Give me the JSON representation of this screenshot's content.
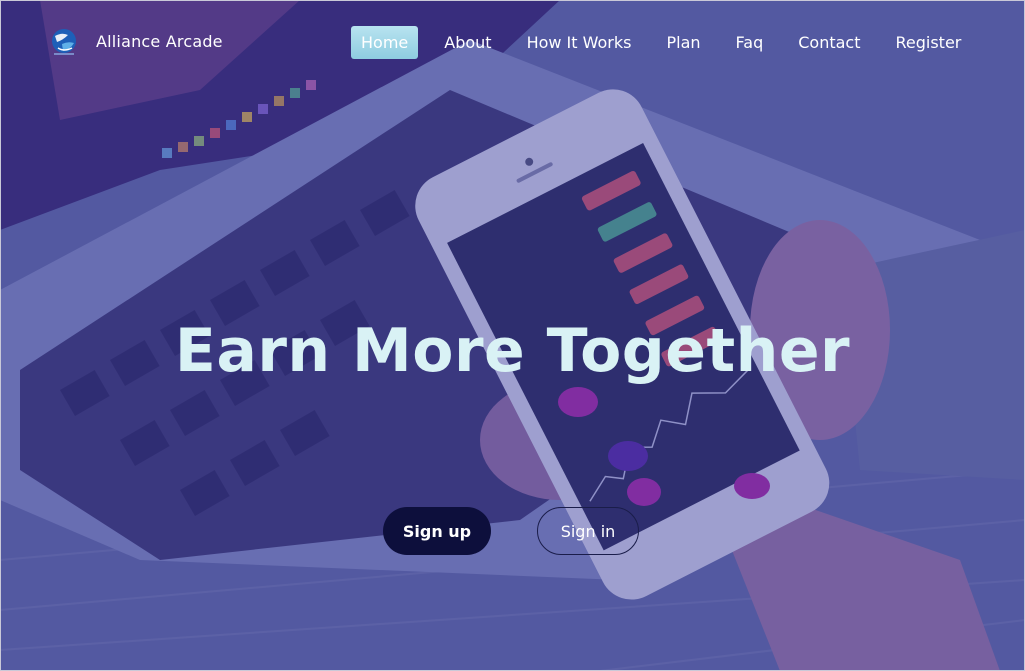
{
  "brand": {
    "name": "Alliance Arcade",
    "logo_icon": "globe-logo-icon"
  },
  "nav": {
    "items": [
      {
        "label": "Home",
        "active": true
      },
      {
        "label": "About",
        "active": false
      },
      {
        "label": "How It Works",
        "active": false
      },
      {
        "label": "Plan",
        "active": false
      },
      {
        "label": "Faq",
        "active": false
      },
      {
        "label": "Contact",
        "active": false
      },
      {
        "label": "Register",
        "active": false
      }
    ]
  },
  "hero": {
    "headline": "Earn More Together",
    "signup_label": "Sign up",
    "signin_label": "Sign in",
    "background_image": "laptop-and-stock-app-phone-photo"
  },
  "colors": {
    "overlay": "#3432a0",
    "headline": "#d9f2f5",
    "active_nav": "#a6d9ea",
    "signup_bg": "#0d0f3c"
  }
}
